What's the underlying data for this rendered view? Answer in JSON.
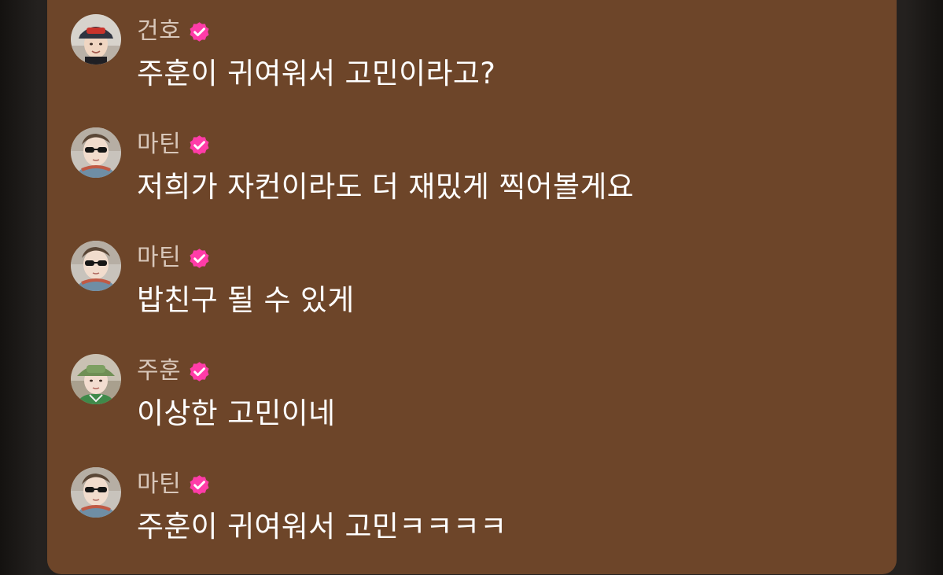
{
  "chat": {
    "messages": [
      {
        "user": "건호",
        "avatar_icon": "avatar-geonho-cap",
        "verified_icon": "verified-badge-icon",
        "text": "주훈이 귀여워서 고민이라고?"
      },
      {
        "user": "마틴",
        "avatar_icon": "avatar-martin-sunglasses",
        "verified_icon": "verified-badge-icon",
        "text": "저희가 자컨이라도 더 재밌게 찍어볼게요"
      },
      {
        "user": "마틴",
        "avatar_icon": "avatar-martin-sunglasses",
        "verified_icon": "verified-badge-icon",
        "text": "밥친구 될 수 있게"
      },
      {
        "user": "주훈",
        "avatar_icon": "avatar-juhoon-green-hat",
        "verified_icon": "verified-badge-icon",
        "text": "이상한 고민이네"
      },
      {
        "user": "마틴",
        "avatar_icon": "avatar-martin-sunglasses",
        "verified_icon": "verified-badge-icon",
        "text": "주훈이 귀여워서 고민ㅋㅋㅋㅋ"
      }
    ]
  },
  "colors": {
    "panel_background": "#6d4529",
    "username": "#d8c7ba",
    "message_text": "#ffffff",
    "verified_badge": "#ff3ca8"
  }
}
